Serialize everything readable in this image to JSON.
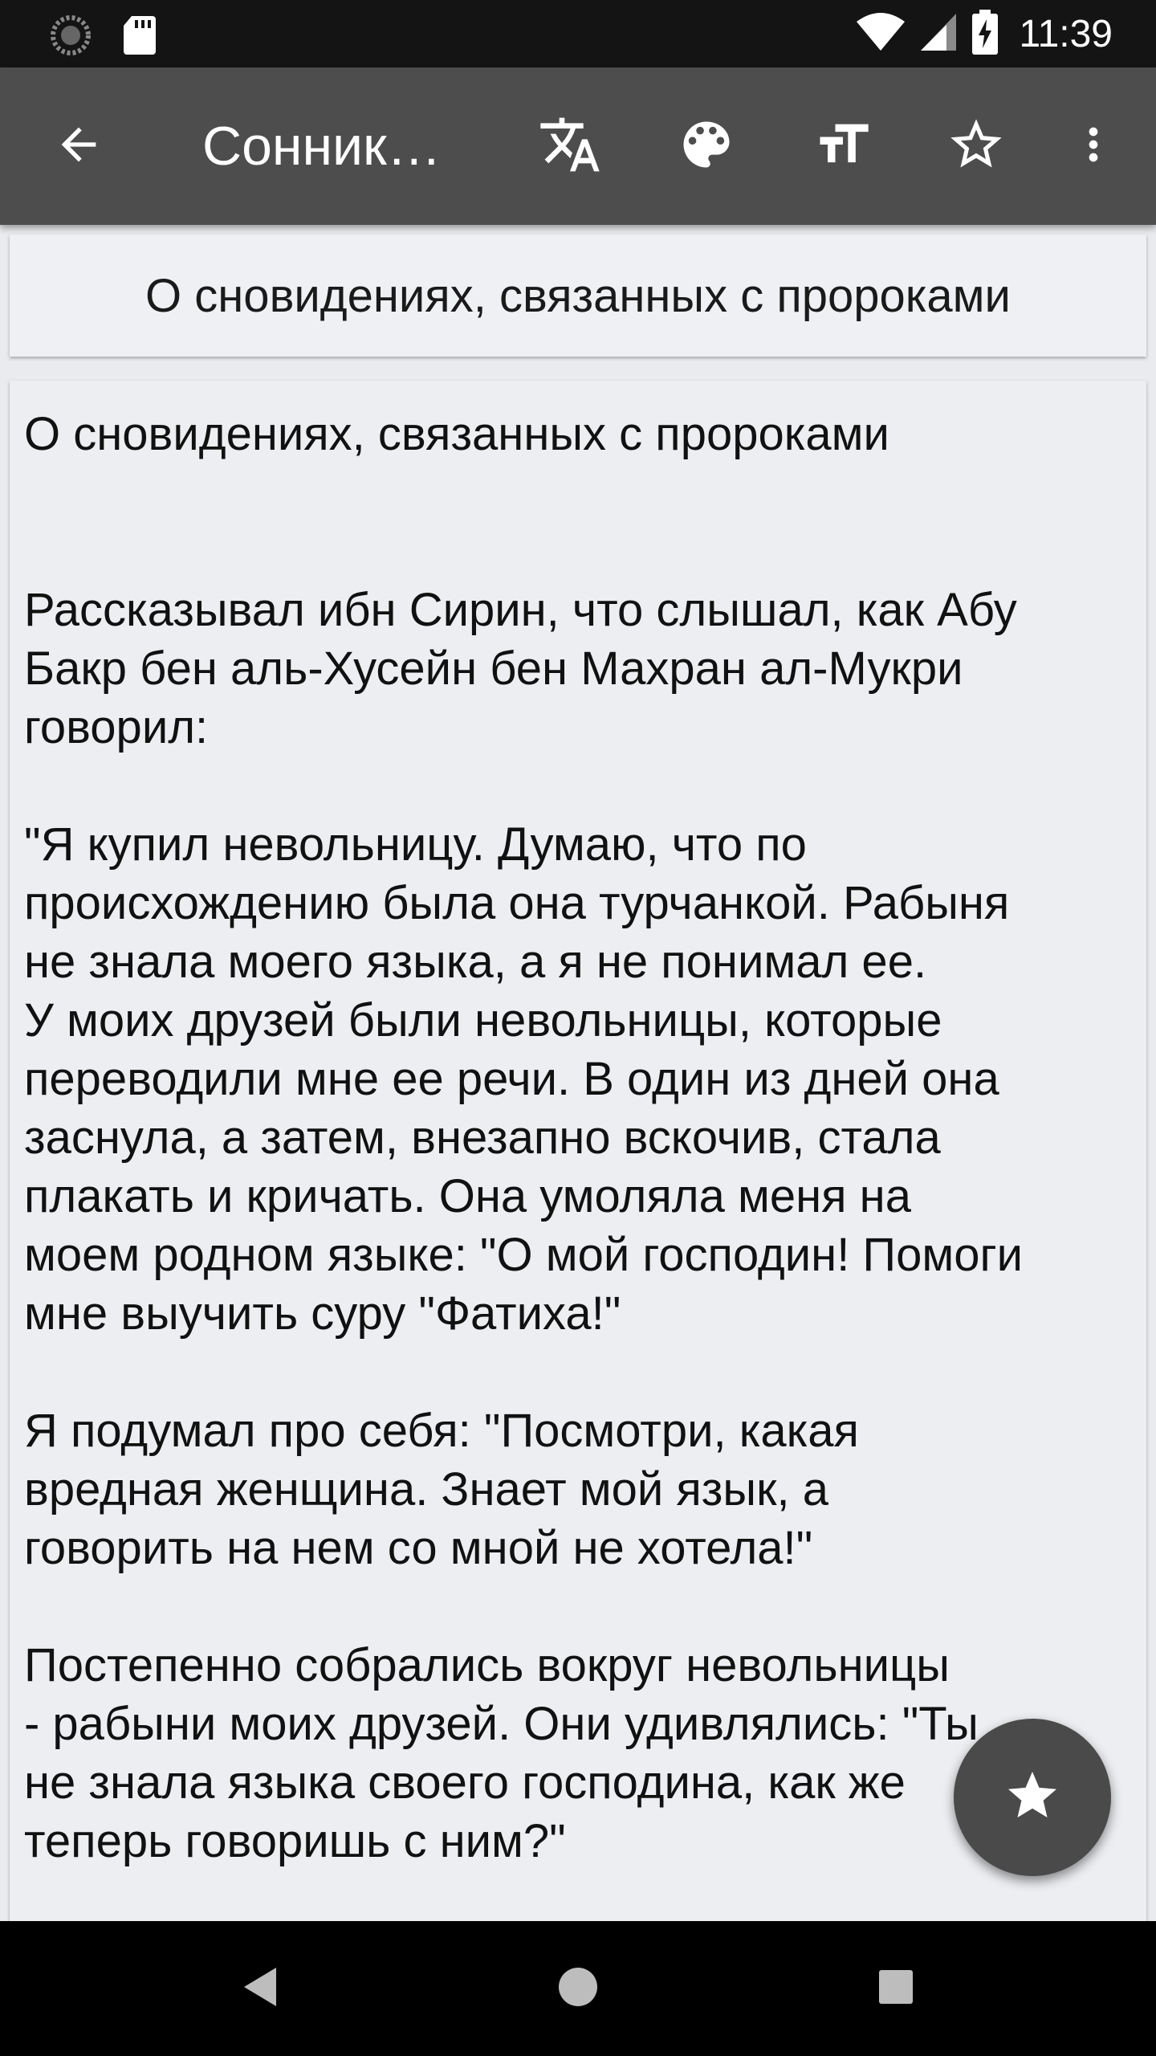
{
  "status_bar": {
    "time": "11:39"
  },
  "app_bar": {
    "title": "Сонник…"
  },
  "header": {
    "title": "О сновидениях, связанных с пророками"
  },
  "content": {
    "heading": "О сновидениях, связанных с пророками",
    "paragraphs": [
      "Рассказывал ибн Сирин, что слышал, как Абу\nБакр бен аль-Хусейн бен Махран ал-Мукри\nговорил:",
      "\"Я купил невольницу. Думаю, что по\nпроисхождению была она турчанкой. Рабыня\nне знала моего языка, а я не понимал ее.\nУ моих друзей были невольницы, которые\nпереводили мне ее речи. В один из дней она\nзаснула, а затем, внезапно вскочив, стала\nплакать и кричать. Она умоляла меня на\nмоем родном языке: \"О мой господин! Помоги\nмне выучить суру \"Фатиха!\"",
      "Я подумал про себя: \"Посмотри, какая\nвредная женщина. Знает мой язык, а\nговорить на нем со мной не хотела!\"",
      "Постепенно собрались вокруг невольницы\n- рабыни моих друзей. Они удивлялись: \"Ты\nне знала языка своего господина, как же\nтеперь говоришь с ним?\""
    ]
  },
  "icons": {
    "back": "arrow-back-icon",
    "translate": "translate-icon",
    "palette": "palette-icon",
    "text_size": "text-size-icon",
    "favorite": "star-outline-icon",
    "more": "more-vert-icon",
    "fab": "star-icon"
  },
  "colors": {
    "status_bar": "#141414",
    "app_bar": "#4d4d4d",
    "background": "#e9ebee",
    "card": "#eceef1",
    "fab": "#4a4a4a",
    "nav_bar": "#000000"
  }
}
